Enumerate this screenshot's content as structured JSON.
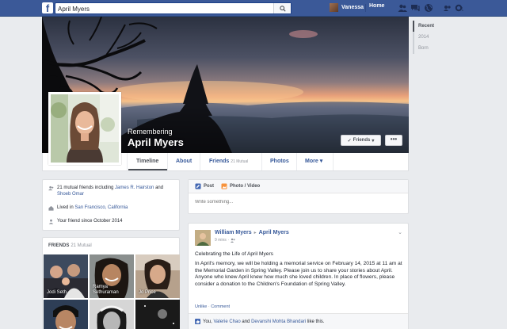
{
  "topbar": {
    "logo": "f",
    "search_value": "April Myers",
    "user_name": "Vanessa",
    "home_label": "Home"
  },
  "years": [
    "Recent",
    "2014",
    "Born"
  ],
  "profile": {
    "remembering": "Remembering",
    "name": "April Myers",
    "friends_button": "Friends",
    "more_button": "•••"
  },
  "nav": {
    "timeline": "Timeline",
    "about": "About",
    "friends": "Friends",
    "friends_mutual": "21 Mutual",
    "photos": "Photos",
    "more": "More"
  },
  "intro": {
    "mutual_prefix": "21 mutual friends including ",
    "mutual_friend_1": "James R. Hairston",
    "mutual_and": " and ",
    "mutual_friend_2": "Shoeb Omar",
    "lived_prefix": "Lived in ",
    "lived_place": "San Francisco, California",
    "friend_since": "Your friend since October 2014"
  },
  "friends_card": {
    "title": "FRIENDS",
    "count": "21 Mutual",
    "tiles": [
      {
        "name": "Jodi Seth"
      },
      {
        "name": "Ramya Sethuraman"
      },
      {
        "name": "Jo Price"
      },
      {
        "name": ""
      },
      {
        "name": ""
      },
      {
        "name": ""
      }
    ]
  },
  "composer": {
    "post_tab": "Post",
    "photo_tab": "Photo / Video",
    "placeholder": "Write something..."
  },
  "post": {
    "author": "William Myers",
    "arrow": "▸",
    "target": "April Myers",
    "time": "9 mins",
    "title": "Celebrating the Life of April Myers",
    "body": "In April's memory, we will be holding a memorial service on February 14, 2015 at 11 am at the Memorial Garden in Spring Valley. Please join us to share your stories about April. Anyone who knew April knew how much she loved children. In place of flowers, please consider a donation to the Children's Foundation of Spring Valley.",
    "unlike": "Unlike",
    "comment": "Comment",
    "likes_you": "You, ",
    "likes_p1": "Valerie Chao",
    "likes_and": " and ",
    "likes_p2": "Devanshi Mohta Bhandari",
    "likes_suffix": " like this."
  }
}
